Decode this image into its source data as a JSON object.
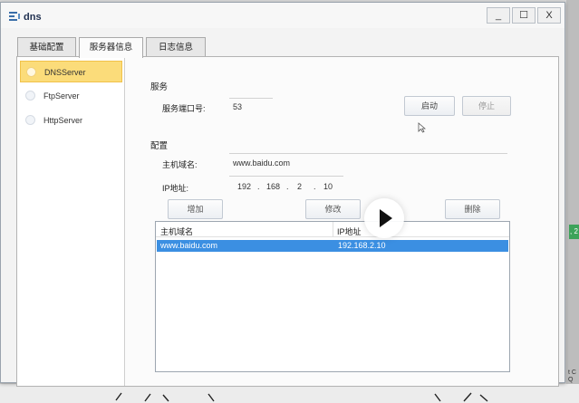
{
  "window": {
    "title": "dns",
    "minimize_label": "_",
    "maximize_label": "☐",
    "close_label": "X"
  },
  "tabs": [
    {
      "label": "基础配置",
      "active": false
    },
    {
      "label": "服务器信息",
      "active": true
    },
    {
      "label": "日志信息",
      "active": false
    }
  ],
  "sidebar": {
    "items": [
      {
        "label": "DNSServer",
        "selected": true
      },
      {
        "label": "FtpServer",
        "selected": false
      },
      {
        "label": "HttpServer",
        "selected": false
      }
    ]
  },
  "service": {
    "section_label": "服务",
    "port_label": "服务端口号:",
    "port_value": "53",
    "start_label": "启动",
    "stop_label": "停止"
  },
  "config": {
    "section_label": "配置",
    "hostname_label": "主机域名:",
    "hostname_value": "www.baidu.com",
    "ip_label": "IP地址:",
    "ip_octets": [
      "192",
      "168",
      "2",
      "10"
    ],
    "ip_separators": [
      ".",
      ".",
      "."
    ],
    "add_label": "增加",
    "modify_label": "修改",
    "delete_label": "删除"
  },
  "table": {
    "columns": [
      "主机域名",
      "IP地址"
    ],
    "rows": [
      {
        "hostname": "www.baidu.com",
        "ip": "192.168.2.10",
        "selected": true
      }
    ]
  },
  "background": {
    "side_tag": ", 2",
    "side_text": "t C\nQ"
  },
  "colors": {
    "selection_blue": "#3b8fe2",
    "sidebar_selected": "#fbdc7a",
    "title_text": "#1f2f4f"
  },
  "icons": [
    "app-icon",
    "play-icon",
    "cursor-icon"
  ]
}
